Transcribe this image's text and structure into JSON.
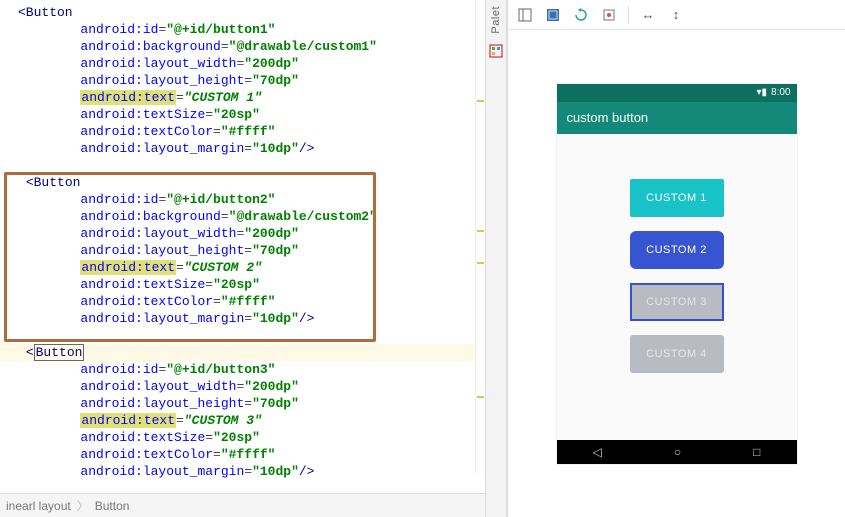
{
  "editor": {
    "buttons": [
      {
        "tag": "Button",
        "attrs": [
          {
            "k": "android:id",
            "v": "\"@+id/button1\""
          },
          {
            "k": "android:background",
            "v": "\"@drawable/custom1\""
          },
          {
            "k": "android:layout_width",
            "v": "\"200dp\""
          },
          {
            "k": "android:layout_height",
            "v": "\"70dp\""
          },
          {
            "k": "android:text",
            "v": "\"CUSTOM 1\"",
            "isText": true
          },
          {
            "k": "android:textSize",
            "v": "\"20sp\""
          },
          {
            "k": "android:textColor",
            "v": "\"#ffff\""
          },
          {
            "k": "android:layout_margin",
            "v": "\"10dp\"",
            "close": true
          }
        ]
      },
      {
        "tag": "Button",
        "attrs": [
          {
            "k": "android:id",
            "v": "\"@+id/button2\""
          },
          {
            "k": "android:background",
            "v": "\"@drawable/custom2\""
          },
          {
            "k": "android:layout_width",
            "v": "\"200dp\""
          },
          {
            "k": "android:layout_height",
            "v": "\"70dp\""
          },
          {
            "k": "android:text",
            "v": "\"CUSTOM 2\"",
            "isText": true
          },
          {
            "k": "android:textSize",
            "v": "\"20sp\""
          },
          {
            "k": "android:textColor",
            "v": "\"#ffff\""
          },
          {
            "k": "android:layout_margin",
            "v": "\"10dp\"",
            "close": true
          }
        ]
      },
      {
        "tag": "Button",
        "cursor": true,
        "attrs": [
          {
            "k": "android:id",
            "v": "\"@+id/button3\""
          },
          {
            "k": "android:layout_width",
            "v": "\"200dp\""
          },
          {
            "k": "android:layout_height",
            "v": "\"70dp\""
          },
          {
            "k": "android:text",
            "v": "\"CUSTOM 3\"",
            "isText": true
          },
          {
            "k": "android:textSize",
            "v": "\"20sp\""
          },
          {
            "k": "android:textColor",
            "v": "\"#ffff\""
          },
          {
            "k": "android:layout_margin",
            "v": "\"10dp\"",
            "close": true
          }
        ]
      }
    ],
    "breadcrumb": [
      "inearl layout",
      "Button"
    ]
  },
  "sideTab": "Palet",
  "design": {
    "toolbar_icons": [
      "layout-icon",
      "blueprint-icon",
      "refresh-icon",
      "zoom-icon"
    ],
    "arrows": [
      "↔",
      "↕"
    ],
    "statusbar_time": "8:00",
    "app_title": "custom button",
    "buttons": [
      {
        "label": "CUSTOM 1",
        "cls": "btn1"
      },
      {
        "label": "CUSTOM 2",
        "cls": "btn2"
      },
      {
        "label": "CUSTOM 3",
        "cls": "btn3"
      },
      {
        "label": "CUSTOM 4",
        "cls": "btn4"
      }
    ],
    "nav": [
      "◁",
      "○",
      "□"
    ]
  }
}
